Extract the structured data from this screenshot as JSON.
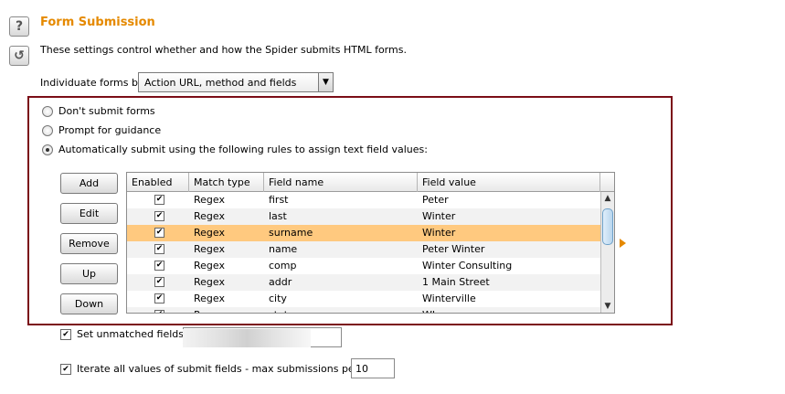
{
  "header": {
    "title": "Form Submission",
    "description": "These settings control whether and how the Spider submits HTML forms."
  },
  "side_buttons": {
    "help": "?",
    "reset": "↺"
  },
  "individuate": {
    "label": "Individuate forms by:",
    "selected": "Action URL, method and fields"
  },
  "radios": [
    {
      "label": "Don't submit forms",
      "checked": false
    },
    {
      "label": "Prompt for guidance",
      "checked": false
    },
    {
      "label": "Automatically submit using the following rules to assign text field values:",
      "checked": true
    }
  ],
  "buttons": [
    "Add",
    "Edit",
    "Remove",
    "Up",
    "Down"
  ],
  "table": {
    "columns": [
      "Enabled",
      "Match type",
      "Field name",
      "Field value"
    ],
    "rows": [
      {
        "enabled": true,
        "match": "Regex",
        "field": "first",
        "value": "Peter"
      },
      {
        "enabled": true,
        "match": "Regex",
        "field": "last",
        "value": "Winter"
      },
      {
        "enabled": true,
        "match": "Regex",
        "field": "surname",
        "value": "Winter",
        "selected": true
      },
      {
        "enabled": true,
        "match": "Regex",
        "field": "name",
        "value": "Peter Winter"
      },
      {
        "enabled": true,
        "match": "Regex",
        "field": "comp",
        "value": "Winter Consulting"
      },
      {
        "enabled": true,
        "match": "Regex",
        "field": "addr",
        "value": "1 Main Street"
      },
      {
        "enabled": true,
        "match": "Regex",
        "field": "city",
        "value": "Winterville"
      },
      {
        "enabled": true,
        "match": "Regex",
        "field": "state",
        "value": "WI"
      }
    ]
  },
  "options": {
    "unmatched_label": "Set unmatched fields to:",
    "unmatched_checked": true,
    "iterate_label": "Iterate all values of submit fields - max submissions per form:",
    "iterate_checked": true,
    "iterate_value": "10"
  },
  "colors": {
    "accent": "#e58900",
    "highlight": "#ffc97f",
    "frame": "#7b0d17"
  }
}
